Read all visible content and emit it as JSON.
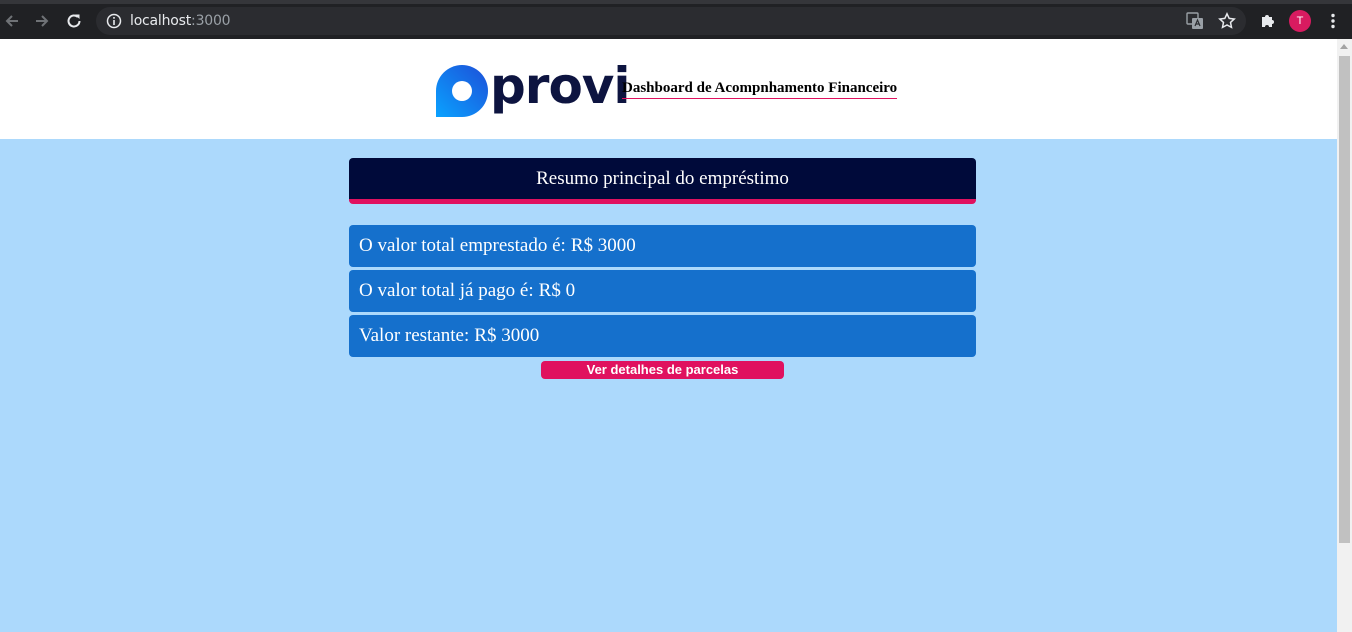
{
  "browser": {
    "url_host": "localhost",
    "url_port": ":3000",
    "avatar_letter": "T"
  },
  "header": {
    "logo_text": "provi",
    "title": "Dashboard de Acompnhamento Financeiro"
  },
  "summary": {
    "title": "Resumo principal do empréstimo",
    "cards": [
      {
        "label": "O valor total emprestado é:",
        "value": "R$ 3000"
      },
      {
        "label": "O valor total já pago é:",
        "value": "R$ 0"
      },
      {
        "label": "Valor restante:",
        "value": "R$ 3000"
      }
    ],
    "details_button": "Ver detalhes de parcelas"
  },
  "colors": {
    "page_bg": "#acd9fc",
    "header_bg": "#000a3a",
    "accent": "#e0115f",
    "card_bg": "#1570cc",
    "logo_dark": "#0d1440"
  }
}
